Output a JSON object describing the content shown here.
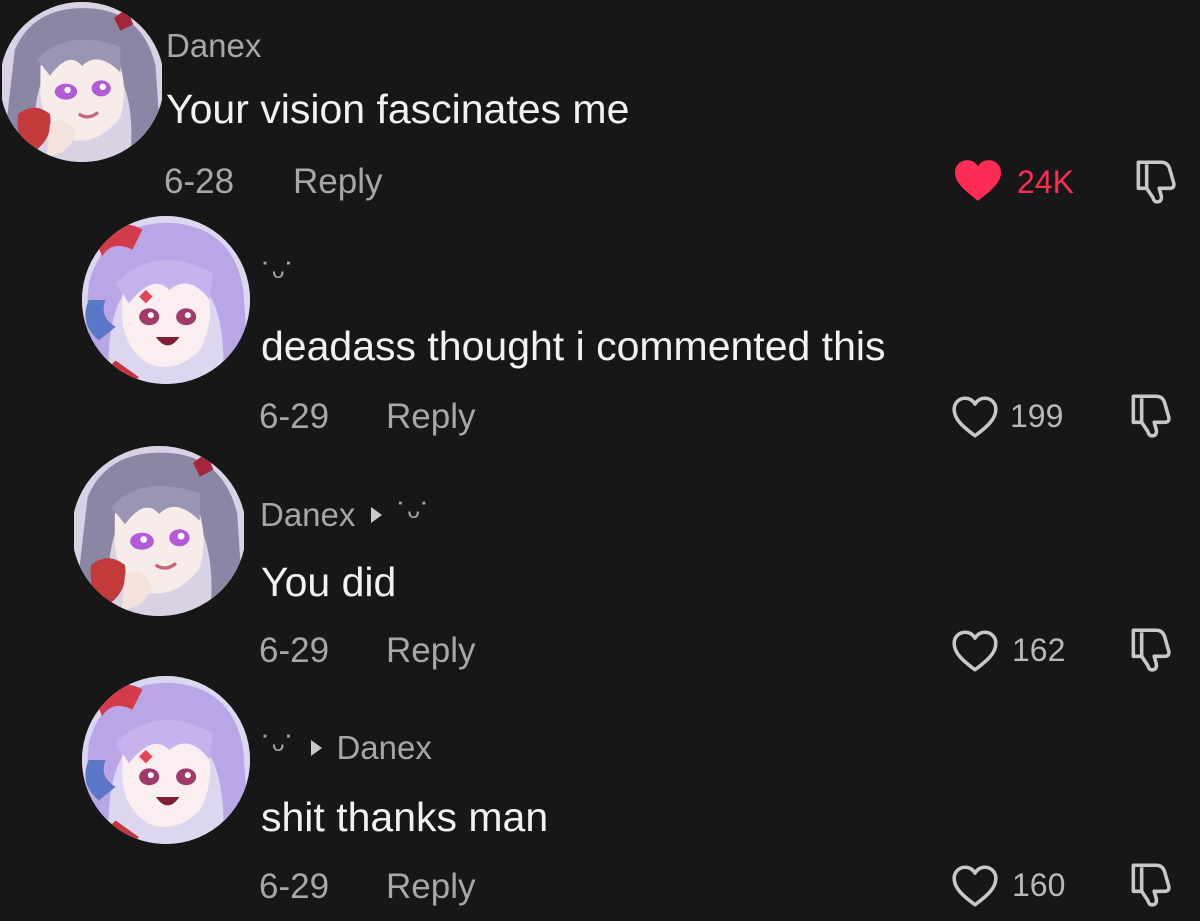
{
  "colors": {
    "background": "#171717",
    "liked": "#fe2c55",
    "muted": "#a7a7a7",
    "text": "#f2f2f2"
  },
  "comments": [
    {
      "username": "Danex",
      "text": "Your vision fascinates me",
      "date": "6-28",
      "reply_label": "Reply",
      "like_count": "24K",
      "liked": true,
      "avatar": "anime-avatar-danex"
    },
    {
      "username": "˙ᵕ˙",
      "text": "deadass thought i commented this",
      "date": "6-29",
      "reply_label": "Reply",
      "like_count": "199",
      "liked": false,
      "avatar": "anime-avatar-purple"
    },
    {
      "username": "Danex",
      "reply_to": "˙ᵕ˙",
      "text": "You did",
      "date": "6-29",
      "reply_label": "Reply",
      "like_count": "162",
      "liked": false,
      "avatar": "anime-avatar-danex"
    },
    {
      "username": "˙ᵕ˙",
      "reply_to": "Danex",
      "text": "shit thanks man",
      "date": "6-29",
      "reply_label": "Reply",
      "like_count": "160",
      "liked": false,
      "avatar": "anime-avatar-purple"
    }
  ]
}
